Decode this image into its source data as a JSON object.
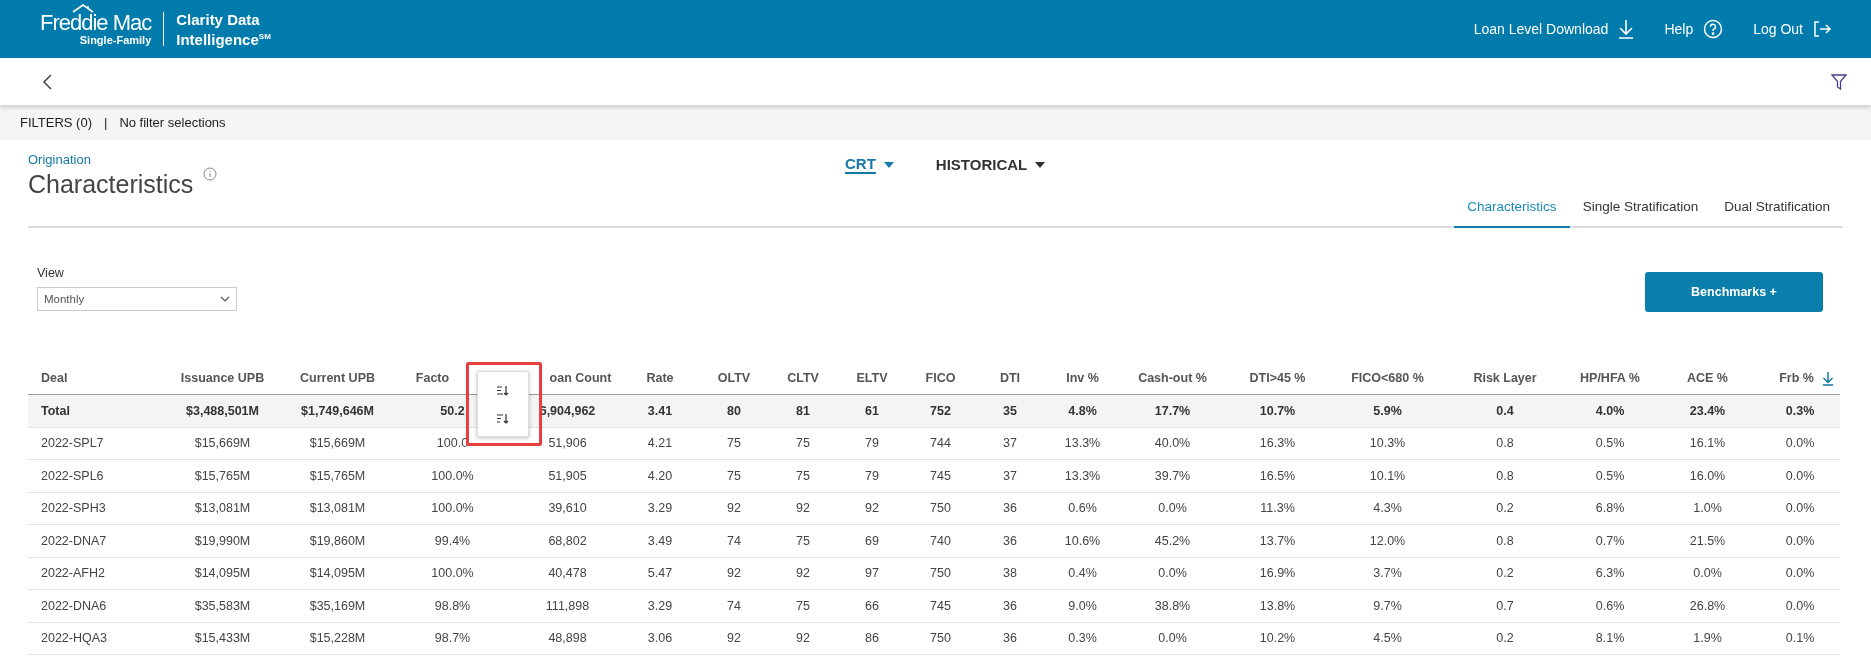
{
  "header": {
    "brand": "Freddie Mac",
    "brand_sub": "Single-Family",
    "product_line1": "Clarity Data",
    "product_line2": "Intelligence$^{SM}$",
    "links": [
      {
        "label": "Loan Level Download",
        "kind": "download"
      },
      {
        "label": "Help",
        "kind": "help"
      },
      {
        "label": "Log Out",
        "kind": "logout"
      }
    ]
  },
  "filters": {
    "label": "FILTERS (0)",
    "separator": "|",
    "text": "No filter selections"
  },
  "page": {
    "section": "Origination",
    "title": "Characteristics"
  },
  "dropdowns": [
    {
      "label": "CRT",
      "selected": true
    },
    {
      "label": "HISTORICAL",
      "selected": false
    }
  ],
  "tabs": [
    {
      "label": "Characteristics",
      "selected": true
    },
    {
      "label": "Single Stratification",
      "selected": false
    },
    {
      "label": "Dual Stratification",
      "selected": false
    }
  ],
  "view": {
    "label": "View",
    "value": "Monthly"
  },
  "benchmarks_button": "Benchmarks +",
  "table": {
    "columns": [
      "Deal",
      "Issuance UPB",
      "Current UPB",
      "Facto",
      "oan Count",
      "Rate",
      "OLTV",
      "CLTV",
      "ELTV",
      "FICO",
      "DTI",
      "Inv %",
      "Cash-out %",
      "DTI>45 %",
      "FICO<680 %",
      "Risk Layer",
      "HP/HFA %",
      "ACE %",
      "Frb %"
    ],
    "rows": [
      {
        "kind": "total",
        "cells": [
          "Total",
          "$3,488,501M",
          "$1,749,646M",
          "50.2",
          "6,904,962",
          "3.41",
          "80",
          "81",
          "61",
          "752",
          "35",
          "4.8%",
          "17.7%",
          "10.7%",
          "5.9%",
          "0.4",
          "4.0%",
          "23.4%",
          "0.3%"
        ]
      },
      {
        "kind": "deal",
        "cells": [
          "2022-SPL7",
          "$15,669M",
          "$15,669M",
          "100.0",
          "51,906",
          "4.21",
          "75",
          "75",
          "79",
          "744",
          "37",
          "13.3%",
          "40.0%",
          "16.3%",
          "10.3%",
          "0.8",
          "0.5%",
          "16.1%",
          "0.0%"
        ]
      },
      {
        "kind": "deal",
        "cells": [
          "2022-SPL6",
          "$15,765M",
          "$15,765M",
          "100.0%",
          "51,905",
          "4.20",
          "75",
          "75",
          "79",
          "745",
          "37",
          "13.3%",
          "39.7%",
          "16.5%",
          "10.1%",
          "0.8",
          "0.5%",
          "16.0%",
          "0.0%"
        ]
      },
      {
        "kind": "deal",
        "cells": [
          "2022-SPH3",
          "$13,081M",
          "$13,081M",
          "100.0%",
          "39,610",
          "3.29",
          "92",
          "92",
          "92",
          "750",
          "36",
          "0.6%",
          "0.0%",
          "11.3%",
          "4.3%",
          "0.2",
          "6.8%",
          "1.0%",
          "0.0%"
        ]
      },
      {
        "kind": "deal",
        "cells": [
          "2022-DNA7",
          "$19,990M",
          "$19,860M",
          "99.4%",
          "68,802",
          "3.49",
          "74",
          "75",
          "69",
          "740",
          "36",
          "10.6%",
          "45.2%",
          "13.7%",
          "12.0%",
          "0.8",
          "0.7%",
          "21.5%",
          "0.0%"
        ]
      },
      {
        "kind": "deal",
        "cells": [
          "2022-AFH2",
          "$14,095M",
          "$14,095M",
          "100.0%",
          "40,478",
          "5.47",
          "92",
          "92",
          "97",
          "750",
          "38",
          "0.4%",
          "0.0%",
          "16.9%",
          "3.7%",
          "0.2",
          "6.3%",
          "0.0%",
          "0.0%"
        ]
      },
      {
        "kind": "deal",
        "cells": [
          "2022-DNA6",
          "$35,583M",
          "$35,169M",
          "98.8%",
          "111,898",
          "3.29",
          "74",
          "75",
          "66",
          "745",
          "36",
          "9.0%",
          "38.8%",
          "13.8%",
          "9.7%",
          "0.7",
          "0.6%",
          "26.8%",
          "0.0%"
        ]
      },
      {
        "kind": "deal",
        "cells": [
          "2022-HQA3",
          "$15,433M",
          "$15,228M",
          "98.7%",
          "48,898",
          "3.06",
          "92",
          "92",
          "86",
          "750",
          "36",
          "0.3%",
          "0.0%",
          "10.2%",
          "4.5%",
          "0.2",
          "8.1%",
          "1.9%",
          "0.1%"
        ]
      }
    ]
  },
  "sort_menu": {
    "highlighted": true,
    "items": [
      {
        "kind": "ascending"
      },
      {
        "kind": "descending"
      }
    ]
  }
}
